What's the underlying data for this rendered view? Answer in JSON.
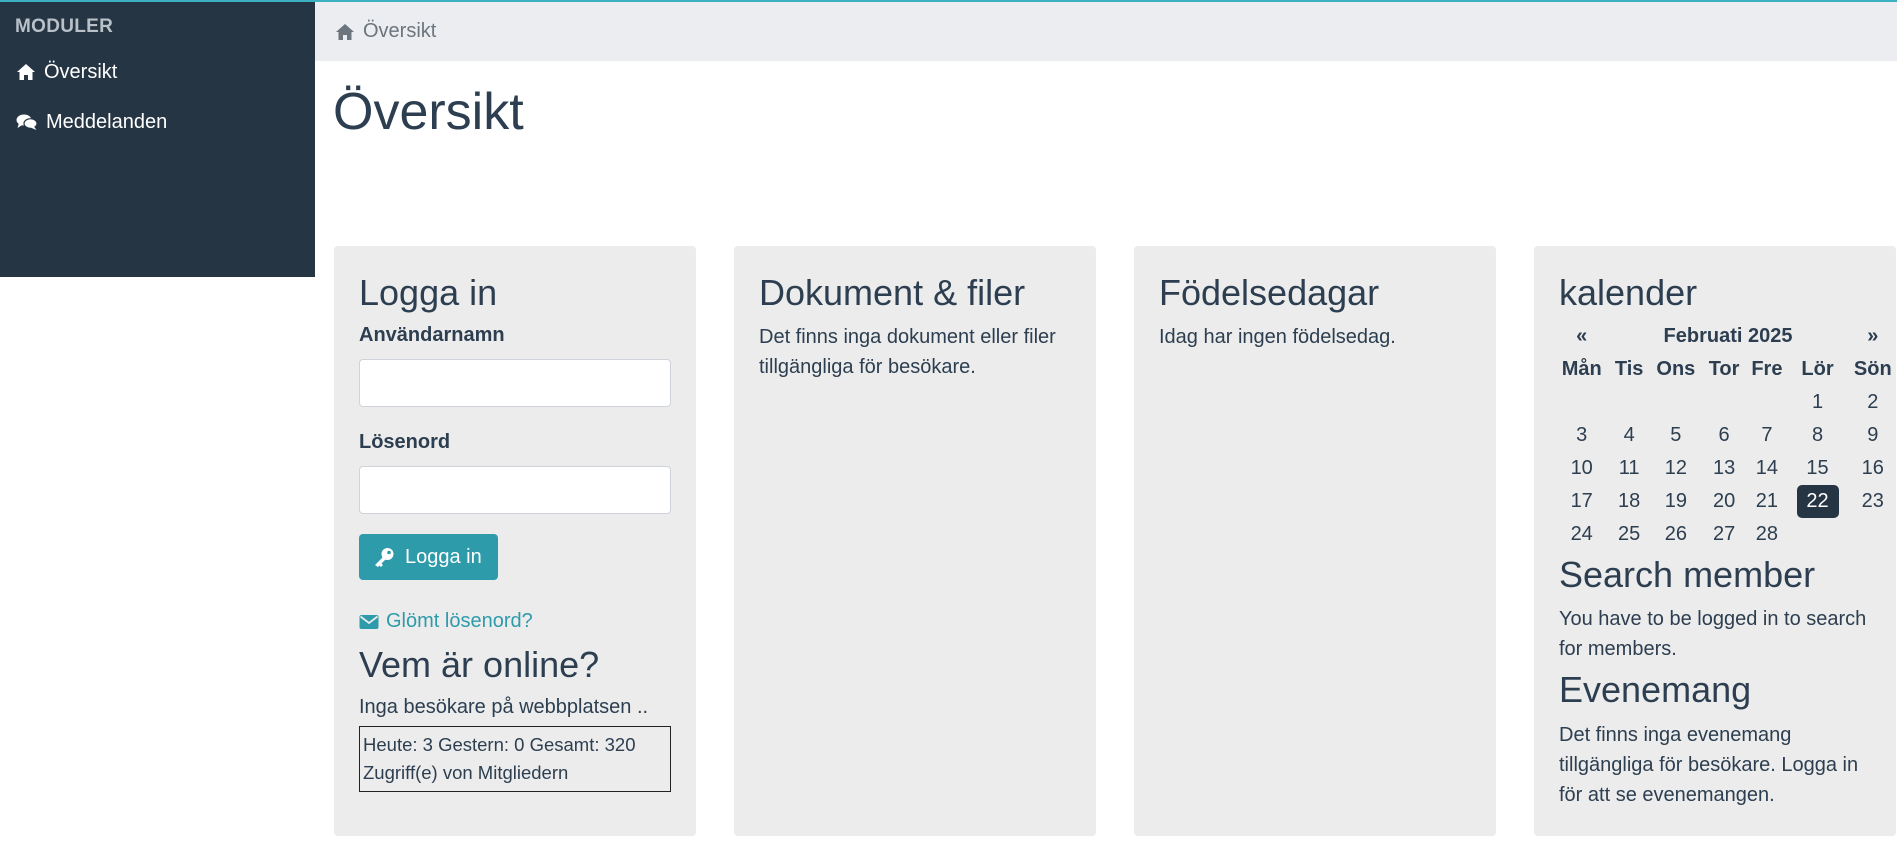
{
  "sidebar": {
    "heading": "MODULER",
    "items": [
      {
        "label": "Översikt",
        "icon": "home-icon"
      },
      {
        "label": "Meddelanden",
        "icon": "comments-icon"
      }
    ]
  },
  "breadcrumb": {
    "label": "Översikt",
    "icon": "home-icon"
  },
  "page_title": "Översikt",
  "login": {
    "title": "Logga in",
    "username_label": "Användarnamn",
    "username_value": "",
    "password_label": "Lösenord",
    "password_value": "",
    "button_label": "Logga in",
    "forgot_label": "Glömt lösenord?"
  },
  "online": {
    "title": "Vem är online?",
    "text": "Inga besökare på webbplatsen ..",
    "counter": "Heute: 3 Gestern: 0 Gesamt: 320 Zugriff(e) von Mitgliedern"
  },
  "documents": {
    "title": "Dokument & filer",
    "text": "Det finns inga dokument eller filer tillgängliga för besökare."
  },
  "birthdays": {
    "title": "Födelsedagar",
    "text": "Idag har ingen födelsedag."
  },
  "calendar": {
    "title": "kalender",
    "prev": "«",
    "next": "»",
    "month": "Februati 2025",
    "weekdays": [
      "Mån",
      "Tis",
      "Ons",
      "Tor",
      "Fre",
      "Lör",
      "Sön"
    ],
    "weeks": [
      [
        "",
        "",
        "",
        "",
        "",
        "1",
        "2"
      ],
      [
        "3",
        "4",
        "5",
        "6",
        "7",
        "8",
        "9"
      ],
      [
        "10",
        "11",
        "12",
        "13",
        "14",
        "15",
        "16"
      ],
      [
        "17",
        "18",
        "19",
        "20",
        "21",
        "22",
        "23"
      ],
      [
        "24",
        "25",
        "26",
        "27",
        "28",
        "",
        ""
      ]
    ],
    "today": "22"
  },
  "search_member": {
    "title": "Search member",
    "text": "You have to be logged in to search for members."
  },
  "events": {
    "title": "Evenemang",
    "text": "Det finns inga evenemang tillgängliga för besökare. Logga in för att se evenemangen."
  },
  "colors": {
    "sidebar_bg": "#263544",
    "accent": "#2e9bab",
    "card_bg": "#ececec",
    "breadcrumb_bg": "#ecedf0"
  }
}
